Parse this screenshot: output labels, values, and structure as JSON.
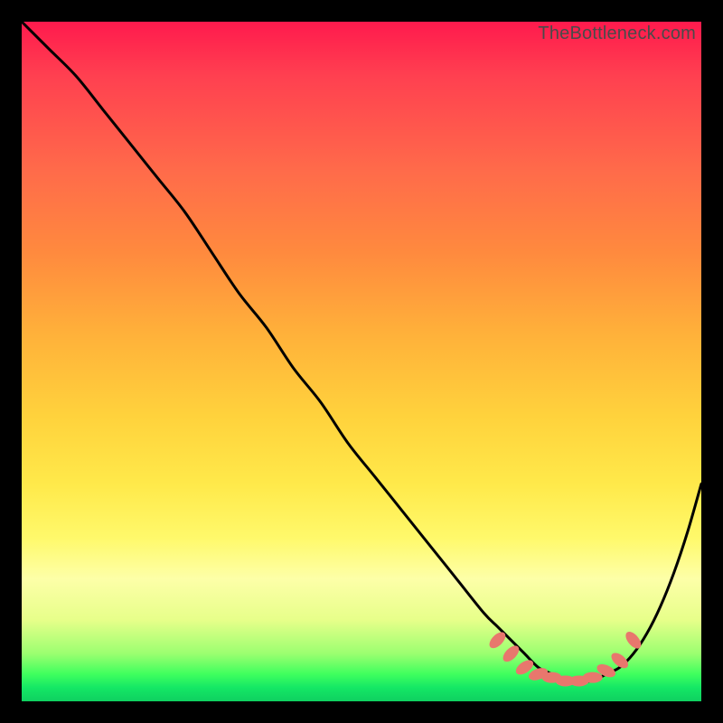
{
  "attribution": "TheBottleneck.com",
  "chart_data": {
    "type": "line",
    "title": "",
    "xlabel": "",
    "ylabel": "",
    "xlim": [
      0,
      100
    ],
    "ylim": [
      0,
      100
    ],
    "series": [
      {
        "name": "bottleneck-curve",
        "x": [
          0,
          4,
          8,
          12,
          16,
          20,
          24,
          28,
          32,
          36,
          40,
          44,
          48,
          52,
          56,
          60,
          64,
          68,
          70,
          72,
          74,
          76,
          78,
          80,
          82,
          84,
          86,
          88,
          90,
          92,
          94,
          96,
          98,
          100
        ],
        "y": [
          100,
          96,
          92,
          87,
          82,
          77,
          72,
          66,
          60,
          55,
          49,
          44,
          38,
          33,
          28,
          23,
          18,
          13,
          11,
          9,
          7,
          5,
          4,
          3,
          3,
          3,
          4,
          5,
          7,
          10,
          14,
          19,
          25,
          32
        ]
      }
    ],
    "markers": {
      "name": "optimal-range",
      "color": "#e8776d",
      "points": [
        {
          "x": 70,
          "y": 9
        },
        {
          "x": 72,
          "y": 7
        },
        {
          "x": 74,
          "y": 5
        },
        {
          "x": 76,
          "y": 4
        },
        {
          "x": 78,
          "y": 3.5
        },
        {
          "x": 80,
          "y": 3
        },
        {
          "x": 82,
          "y": 3
        },
        {
          "x": 84,
          "y": 3.5
        },
        {
          "x": 86,
          "y": 4.5
        },
        {
          "x": 88,
          "y": 6
        },
        {
          "x": 90,
          "y": 9
        }
      ]
    }
  }
}
